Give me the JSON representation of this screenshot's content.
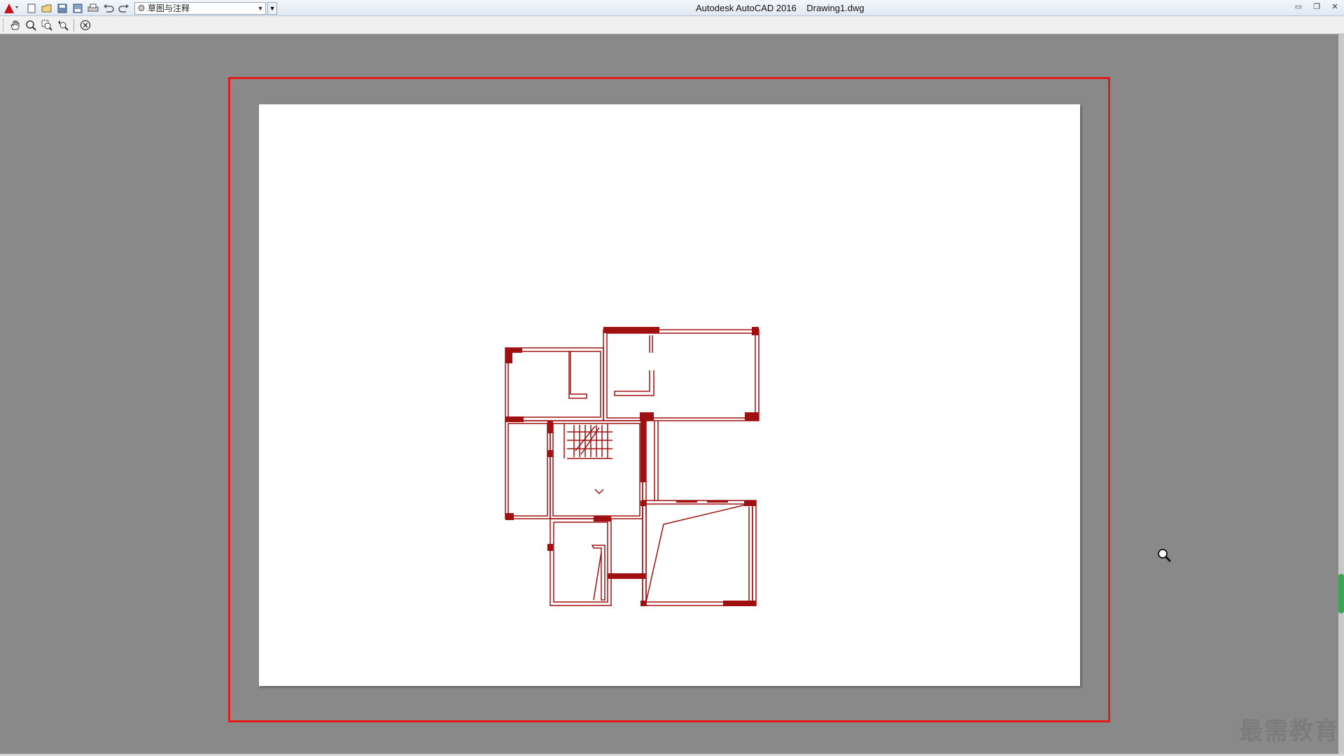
{
  "app": {
    "title": "Autodesk AutoCAD 2016    Drawing1.dwg",
    "logo_icon": "autocad-logo-icon"
  },
  "quick_access": {
    "buttons": [
      "new-icon",
      "open-icon",
      "save-icon",
      "save-as-icon",
      "plot-icon",
      "undo-icon",
      "redo-icon"
    ],
    "workspace": "草图与注释"
  },
  "toolbar": {
    "buttons": [
      "pan-icon",
      "zoom-realtime-icon",
      "zoom-window-icon",
      "zoom-previous-icon",
      "close-preview-icon"
    ]
  },
  "watermark": "最需教育",
  "colors": {
    "frame": "#e31b1b",
    "plan": "#a01010",
    "background": "#898989",
    "paper": "#ffffff"
  }
}
